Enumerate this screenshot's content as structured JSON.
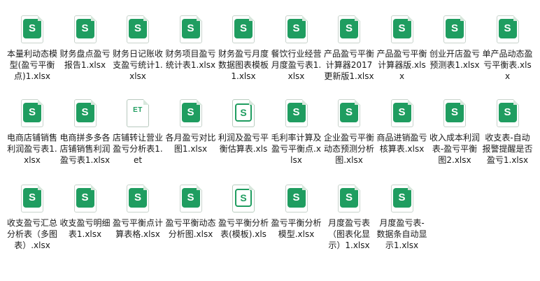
{
  "files": [
    {
      "name": "本量利动态模型(盈亏平衡点)1.xlsx",
      "icon": "xlsx-icon"
    },
    {
      "name": "财务盘点盈亏报告1.xlsx",
      "icon": "xlsx-icon"
    },
    {
      "name": "财务日记账收支盈亏统计1.xlsx",
      "icon": "xlsx-icon"
    },
    {
      "name": "财务项目盈亏统计表1.xlsx",
      "icon": "xlsx-icon"
    },
    {
      "name": "财务盈亏月度数据图表模板1.xlsx",
      "icon": "xlsx-icon"
    },
    {
      "name": "餐饮行业经营月度盈亏表1.xlsx",
      "icon": "xlsx-icon"
    },
    {
      "name": "产品盈亏平衡计算器2017更新版1.xlsx",
      "icon": "xlsx-icon"
    },
    {
      "name": "产品盈亏平衡计算器版.xlsx",
      "icon": "xlsx-icon"
    },
    {
      "name": "创业开店盈亏预测表1.xlsx",
      "icon": "xlsx-icon"
    },
    {
      "name": "单产品动态盈亏平衡表.xlsx",
      "icon": "xlsx-icon"
    },
    {
      "name": "电商店铺销售利润盈亏表1.xlsx",
      "icon": "xlsx-icon"
    },
    {
      "name": "电商拼多多各店铺销售利润盈亏表1.xlsx",
      "icon": "xlsx-icon"
    },
    {
      "name": "店铺转让营业盈亏分析表1.et",
      "icon": "et-icon"
    },
    {
      "name": "各月盈亏对比图1.xlsx",
      "icon": "xlsx-icon"
    },
    {
      "name": "利润及盈亏平衡估算表.xls",
      "icon": "xls-icon"
    },
    {
      "name": "毛利率计算及盈亏平衡点.xlsx",
      "icon": "xlsx-icon"
    },
    {
      "name": "企业盈亏平衡动态预测分析图.xlsx",
      "icon": "xlsx-icon"
    },
    {
      "name": "商品进销盈亏核算表.xlsx",
      "icon": "xlsx-icon"
    },
    {
      "name": "收入成本利润表-盈亏平衡图2.xlsx",
      "icon": "xlsx-icon"
    },
    {
      "name": "收支表-自动报警提醒是否盈亏1.xlsx",
      "icon": "xlsx-icon"
    },
    {
      "name": "收支盈亏汇总分析表（多图表）.xlsx",
      "icon": "xlsx-icon"
    },
    {
      "name": "收支盈亏明细表1.xlsx",
      "icon": "xlsx-icon"
    },
    {
      "name": "盈亏平衡点计算表格.xlsx",
      "icon": "xlsx-icon"
    },
    {
      "name": "盈亏平衡动态分析图.xlsx",
      "icon": "xlsx-icon"
    },
    {
      "name": "盈亏平衡分析表(模板).xls",
      "icon": "xls-icon"
    },
    {
      "name": "盈亏平衡分析模型.xlsx",
      "icon": "xlsx-icon"
    },
    {
      "name": "月度盈亏表（图表化显示）1.xlsx",
      "icon": "xlsx-icon"
    },
    {
      "name": "月度盈亏表-数据条自动显示1.xlsx",
      "icon": "xlsx-icon"
    }
  ],
  "icon_glyphs": {
    "xlsx": "S",
    "xls": "S",
    "et": "ET"
  },
  "colors": {
    "accent": "#1f9d60",
    "background": "#ffffff",
    "text": "#1a1a1a"
  }
}
